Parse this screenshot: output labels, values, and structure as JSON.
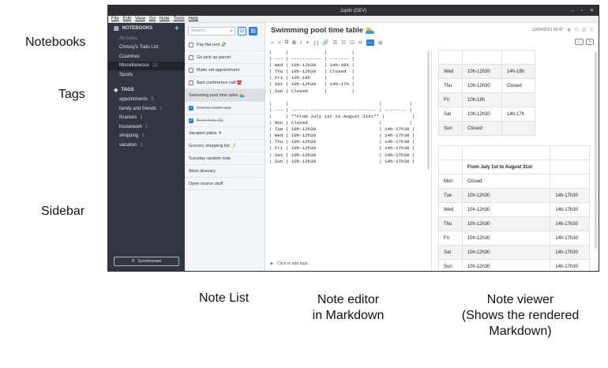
{
  "annotations": {
    "notebooks": "Notebooks",
    "tags": "Tags",
    "sidebar": "Sidebar",
    "note_list": "Note List",
    "note_editor_l1": "Note editor",
    "note_editor_l2": "in Markdown",
    "note_viewer_l1": "Note viewer",
    "note_viewer_l2": "(Shows the rendered",
    "note_viewer_l3": "Markdown)"
  },
  "window": {
    "title": "Joplin (DEV)",
    "menu": [
      "File",
      "Edit",
      "View",
      "Go",
      "Note",
      "Tools",
      "Help"
    ]
  },
  "sidebar": {
    "notebooks_header": "NOTEBOOKS",
    "notebooks": [
      {
        "label": "All notes",
        "count": ""
      },
      {
        "label": "Chrissy's Todo List",
        "count": ""
      },
      {
        "label": "Countries",
        "count": ""
      },
      {
        "label": "Miscellaneous",
        "count": "12"
      },
      {
        "label": "Sports",
        "count": ""
      }
    ],
    "tags_header": "TAGS",
    "tags": [
      {
        "label": "appointments",
        "count": "3"
      },
      {
        "label": "family and friends",
        "count": "1"
      },
      {
        "label": "finances",
        "count": "1"
      },
      {
        "label": "housework",
        "count": "1"
      },
      {
        "label": "shopping",
        "count": "1"
      },
      {
        "label": "vacation",
        "count": "1"
      }
    ],
    "sync_label": "Synchronise"
  },
  "note_list": {
    "search_placeholder": "Search...",
    "items": [
      {
        "title": "Pay flat rent 💸",
        "todo": true,
        "done": false
      },
      {
        "title": "Go pick up parcel",
        "todo": true,
        "done": false
      },
      {
        "title": "Make vet appointment",
        "todo": true,
        "done": false
      },
      {
        "title": "8am conference call ☎️",
        "todo": true,
        "done": false
      },
      {
        "title": "Swimming pool time table 🏊",
        "todo": false,
        "done": false
      },
      {
        "title": "Deploy Joplin app",
        "todo": true,
        "done": true
      },
      {
        "title": "Book ferry ⛴",
        "todo": true,
        "done": true
      },
      {
        "title": "Vacation plans ☀",
        "todo": false,
        "done": false
      },
      {
        "title": "Grocery shopping list 📝",
        "todo": false,
        "done": false
      },
      {
        "title": "Tuesday random note",
        "todo": false,
        "done": false
      },
      {
        "title": "Work itinerary",
        "todo": false,
        "done": false
      },
      {
        "title": "Open source stuff",
        "todo": false,
        "done": false
      }
    ]
  },
  "note": {
    "title": "Swimming pool time table 🏊",
    "timestamp": "02/04/2021 00:47",
    "toolbar": [
      "<",
      ">",
      "⧉",
      "B",
      "I",
      "⚭",
      "{;}",
      "🔗",
      "☰",
      "☷",
      "☑",
      "H",
      "⋯",
      "⊞"
    ],
    "markdown": "|     |             |         |\n| --- | ----------- | ------- |\n| Wed | 10h-12h30   | 14h-18h |\n| Thu | 10h-12h30   | Closed  |\n| Fri | 10h-18h     |         |\n| Sat | 10h-12h30   | 14h-17h |\n| Sun | Closed      |         |\n\n|     |                                 |          |\n| --- | ------------------------------- | -------- |\n|     | **From July 1st to August 31st** |          |\n| Mon | Closed                          |          |\n| Tue | 10h-12h30                       | 14h-17h30 |\n| Wed | 10h-12h30                       | 14h-17h30 |\n| Thu | 10h-12h30                       | 14h-17h30 |\n| Fri | 10h-12h30                       | 14h-17h30 |\n| Sat | 10h-12h30                       | 14h-17h30 |\n| Sun | 10h-12h30                       | 14h-17h30 |",
    "tags_prompt": "Click to add tags...",
    "viewer_table1": [
      [
        "",
        "",
        ""
      ],
      [
        "Wed",
        "10h-12h30",
        "14h-18h"
      ],
      [
        "Thu",
        "10h-12h30",
        "Closed"
      ],
      [
        "Fri",
        "10h-18h",
        ""
      ],
      [
        "Sat",
        "10h-12h30",
        "14h-17h"
      ],
      [
        "Sun",
        "Closed",
        ""
      ]
    ],
    "viewer_table2": [
      [
        "",
        "",
        ""
      ],
      [
        "",
        "From July 1st to August 31st",
        ""
      ],
      [
        "Mon",
        "Closed",
        ""
      ],
      [
        "Tue",
        "10h-12h30",
        "14h-17h30"
      ],
      [
        "Wed",
        "10h-12h30",
        "14h-17h30"
      ],
      [
        "Thu",
        "10h-12h30",
        "14h-17h30"
      ],
      [
        "Fri",
        "10h-12h30",
        "14h-17h30"
      ],
      [
        "Sat",
        "10h-12h30",
        "14h-17h30"
      ],
      [
        "Sun",
        "10h-12h30",
        "14h-17h30"
      ]
    ]
  }
}
